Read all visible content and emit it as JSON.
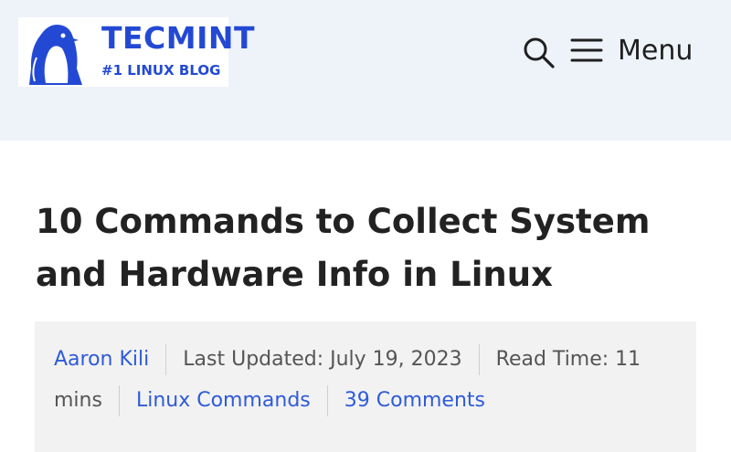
{
  "header": {
    "logo": {
      "name": "TECMINT",
      "tagline": "#1 LINUX BLOG"
    },
    "search_icon": "search-icon",
    "menu": {
      "icon": "hamburger-icon",
      "label": "Menu"
    }
  },
  "article": {
    "title": "10 Commands to Collect System and Hardware Info in Linux",
    "meta": {
      "author": "Aaron Kili",
      "last_updated": "Last Updated: July 19, 2023",
      "read_time_line1": "Read Time: 11",
      "read_time_line2": "mins",
      "category": "Linux Commands",
      "comments": "39 Comments"
    }
  },
  "colors": {
    "header_bg": "#eef3fa",
    "brand_blue": "#2349d4",
    "link_blue": "#2f5bd8",
    "meta_bg": "#f2f2f2"
  }
}
